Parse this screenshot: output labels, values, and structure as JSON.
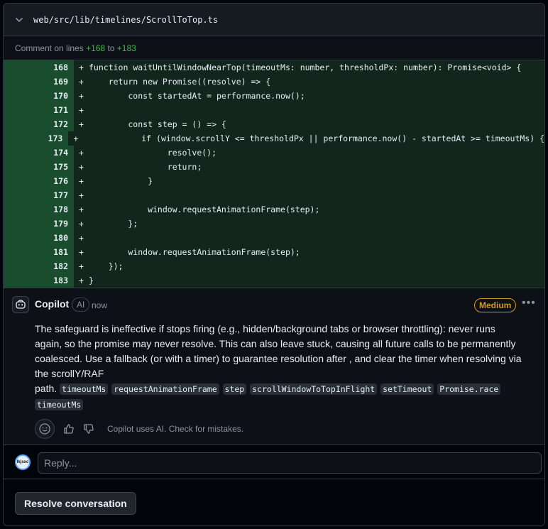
{
  "file_header": {
    "path": "web/src/lib/timelines/ScrollToTop.ts"
  },
  "comment_on": {
    "prefix": "Comment on lines",
    "start": "+168",
    "sep": "to",
    "end": "+183"
  },
  "diff": {
    "lines": [
      {
        "num": "168",
        "sign": "+",
        "code": "function waitUntilWindowNearTop(timeoutMs: number, thresholdPx: number): Promise<void> {"
      },
      {
        "num": "169",
        "sign": "+",
        "code": "    return new Promise((resolve) => {"
      },
      {
        "num": "170",
        "sign": "+",
        "code": "        const startedAt = performance.now();"
      },
      {
        "num": "171",
        "sign": "+",
        "code": ""
      },
      {
        "num": "172",
        "sign": "+",
        "code": "        const step = () => {"
      },
      {
        "num": "173",
        "sign": "+",
        "code": "            if (window.scrollY <= thresholdPx || performance.now() - startedAt >= timeoutMs) {"
      },
      {
        "num": "174",
        "sign": "+",
        "code": "                resolve();"
      },
      {
        "num": "175",
        "sign": "+",
        "code": "                return;"
      },
      {
        "num": "176",
        "sign": "+",
        "code": "            }"
      },
      {
        "num": "177",
        "sign": "+",
        "code": ""
      },
      {
        "num": "178",
        "sign": "+",
        "code": "            window.requestAnimationFrame(step);"
      },
      {
        "num": "179",
        "sign": "+",
        "code": "        };"
      },
      {
        "num": "180",
        "sign": "+",
        "code": ""
      },
      {
        "num": "181",
        "sign": "+",
        "code": "        window.requestAnimationFrame(step);"
      },
      {
        "num": "182",
        "sign": "+",
        "code": "    });"
      },
      {
        "num": "183",
        "sign": "+",
        "code": "}"
      }
    ]
  },
  "comment": {
    "author": "Copilot",
    "badge": "AI",
    "time": "now",
    "severity": "Medium",
    "body": "The safeguard is ineffective if stops firing (e.g., hidden/background tabs or browser throttling): never runs again, so the promise may never resolve. This can also leave stuck, causing all future calls to be permanently coalesced. Use a fallback (or with a timer) to guarantee resolution after , and clear the timer when resolving via the scrollY/RAF",
    "path_word": "path.",
    "code_refs": [
      "timeoutMs",
      "requestAnimationFrame",
      "step",
      "scrollWindowToTopInFlight",
      "setTimeout",
      "Promise.race",
      "timeoutMs"
    ],
    "disclaimer": "Copilot uses AI. Check for mistakes."
  },
  "reply": {
    "avatar_text": "lkjsxc",
    "placeholder": "Reply..."
  },
  "footer": {
    "resolve_label": "Resolve conversation"
  },
  "colors": {
    "added_line_bg": "#12261e",
    "added_num_bg": "#1a4d2e",
    "severity_medium": "#d29922",
    "addition_text": "#3fb950"
  }
}
